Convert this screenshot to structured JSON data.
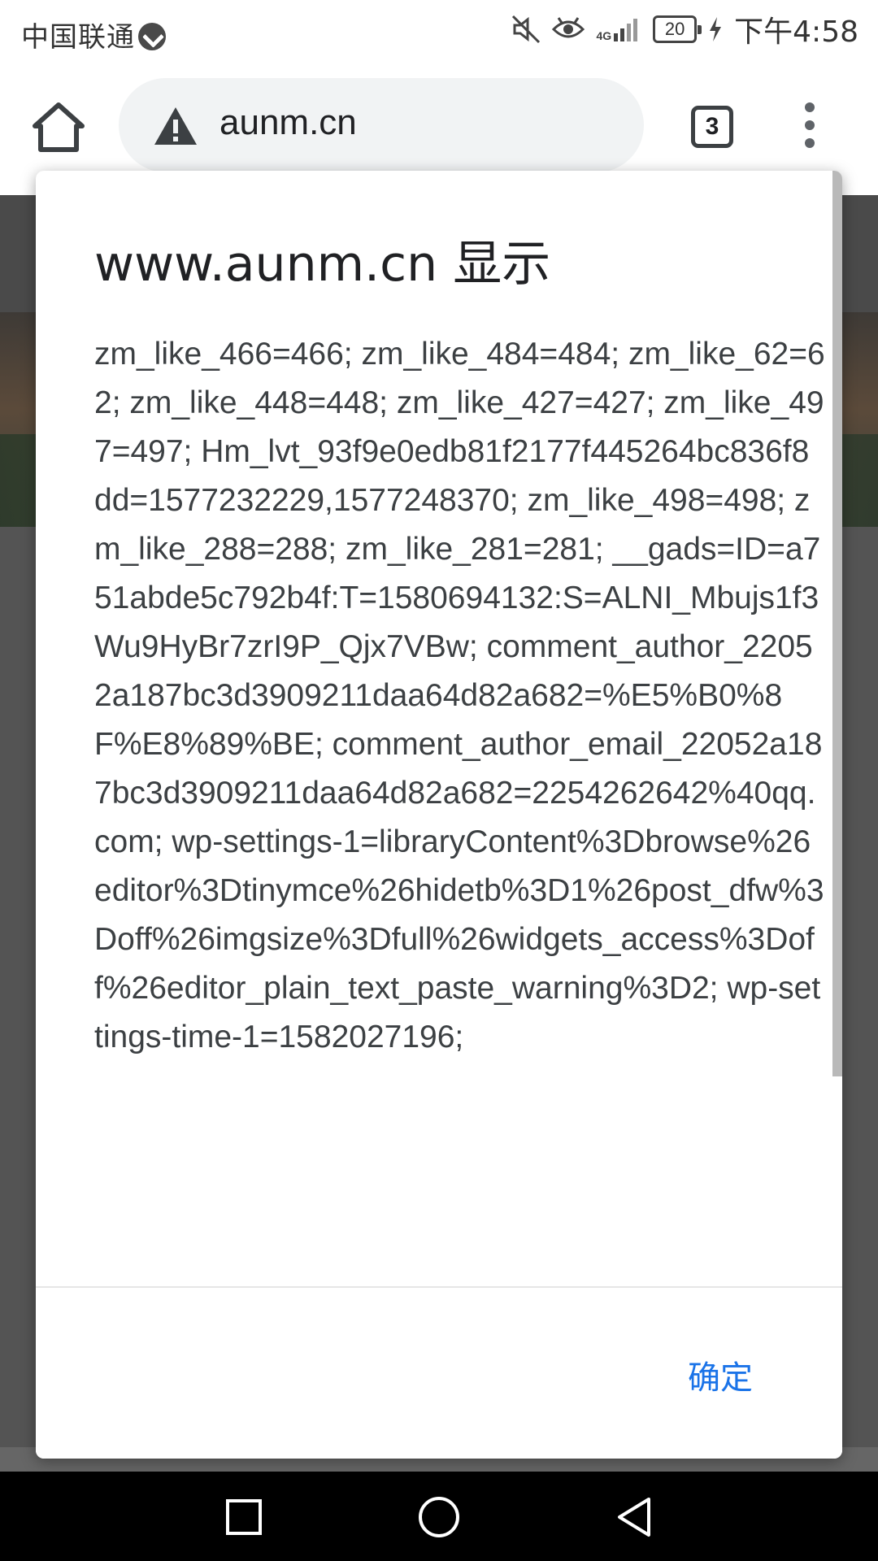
{
  "status_bar": {
    "carrier": "中国联通",
    "network": "4G",
    "battery": "20",
    "time": "下午4:58",
    "icons": [
      "mute-icon",
      "eye-comfort-icon",
      "signal-icon",
      "battery-icon",
      "charging-icon"
    ]
  },
  "browser": {
    "url": "aunm.cn",
    "tab_count": "3",
    "icons": [
      "home-icon",
      "not-secure-warning-icon",
      "tab-switcher-icon",
      "more-vert-icon"
    ]
  },
  "dialog": {
    "title": "www.aunm.cn 显示",
    "message": "zm_like_466=466; zm_like_484=484; zm_like_62=62; zm_like_448=448; zm_like_427=427; zm_like_497=497; Hm_lvt_93f9e0edb81f2177f445264bc836f8dd=1577232229,1577248370; zm_like_498=498; zm_like_288=288; zm_like_281=281; __gads=ID=a751abde5c792b4f:T=1580694132:S=ALNI_Mbujs1f3Wu9HyBr7zrI9P_Qjx7VBw; comment_author_22052a187bc3d3909211daa64d82a682=%E5%B0%8F%E8%89%BE; comment_author_email_22052a187bc3d3909211daa64d82a682=2254262642%40qq.com; wp-settings-1=libraryContent%3Dbrowse%26editor%3Dtinymce%26hidetb%3D1%26post_dfw%3Doff%26imgsize%3Dfull%26widgets_access%3Doff%26editor_plain_text_paste_warning%3D2; wp-settings-time-1=1582027196;",
    "ok_label": "确定"
  },
  "nav_bar": {
    "icons": [
      "recents-icon",
      "home-circle-icon",
      "back-icon"
    ]
  }
}
